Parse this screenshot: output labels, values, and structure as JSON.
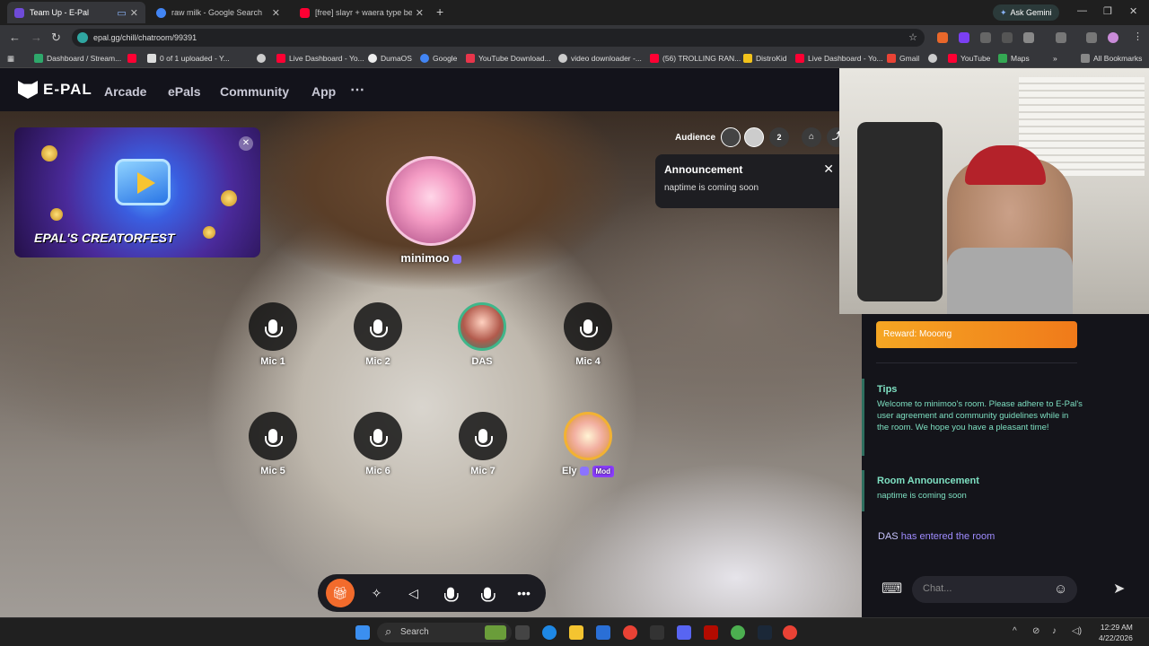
{
  "browser": {
    "tabs": [
      {
        "title": "Team Up - E-Pal",
        "active": true,
        "favicon_color": "#6f4bd8"
      },
      {
        "title": "raw milk - Google Search",
        "active": false,
        "favicon_color": "#4285f4"
      },
      {
        "title": "[free] slayr + waera type beat -",
        "active": false,
        "favicon_color": "#ff0033"
      }
    ],
    "ask_gemini": "Ask Gemini",
    "url": "epal.gg/chill/chatroom/99391",
    "bookmarks": [
      "Dashboard / Stream...",
      "0 of 1 uploaded - Y...",
      "Live Dashboard - Yo...",
      "DumaOS",
      "Google",
      "YouTube Download...",
      "video downloader -...",
      "(56) TROLLING RAN...",
      "DistroKid",
      "Live Dashboard - Yo...",
      "Gmail",
      "YouTube",
      "Maps"
    ],
    "all_bookmarks": "All Bookmarks"
  },
  "site": {
    "logo": "E-PAL",
    "nav": [
      "Arcade",
      "ePals",
      "Community",
      "App"
    ],
    "more_icon": "⋯"
  },
  "room": {
    "promo_title": "EPAL'S CREATORFEST",
    "audience_label": "Audience",
    "audience_count": "2",
    "announcement": {
      "title": "Announcement",
      "text": "naptime is coming soon"
    },
    "host": {
      "name": "minimoo"
    },
    "seats": [
      {
        "label": "Mic 1",
        "occupied": false
      },
      {
        "label": "Mic 2",
        "occupied": false
      },
      {
        "label": "DAS",
        "occupied": true
      },
      {
        "label": "Mic 4",
        "occupied": false
      },
      {
        "label": "Mic 5",
        "occupied": false
      },
      {
        "label": "Mic 6",
        "occupied": false
      },
      {
        "label": "Mic 7",
        "occupied": false
      },
      {
        "label": "Ely",
        "occupied": true,
        "badge": "Mod"
      }
    ]
  },
  "chat": {
    "reward": "Reward: Mooong",
    "tips_title": "Tips",
    "tips_text": "Welcome to minimoo's room. Please adhere to E-Pal's user agreement and community guidelines while in the room. We hope you have a pleasant time!",
    "room_announcement_title": "Room Announcement",
    "room_announcement_text": "naptime is coming soon",
    "entered_user": "DAS",
    "entered_text": "has entered the room",
    "input_placeholder": "Chat..."
  },
  "taskbar": {
    "search": "Search",
    "time": "12:29 AM",
    "date": "4/22/2026"
  },
  "colors": {
    "accent_teal": "#7ee0c2",
    "reward_orange": "#f5a623",
    "mod_purple": "#8b3dff",
    "gift_orange": "#f26b2c"
  }
}
